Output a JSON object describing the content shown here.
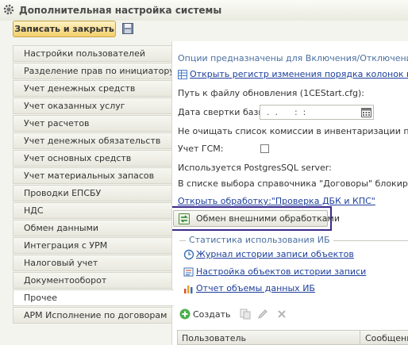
{
  "window": {
    "title": "Дополнительная настройка системы"
  },
  "toolbar": {
    "save_close_label": "Записать и закрыть"
  },
  "sidebar": {
    "items": [
      {
        "label": "Настройки пользователей"
      },
      {
        "label": "Разделение прав по инициатору"
      },
      {
        "label": "Учет денежных средств"
      },
      {
        "label": "Учет оказанных услуг"
      },
      {
        "label": "Учет расчетов"
      },
      {
        "label": "Учет денежных обязательств"
      },
      {
        "label": "Учет основных средств"
      },
      {
        "label": "Учет материальных запасов"
      },
      {
        "label": "Проводки ЕПСБУ"
      },
      {
        "label": "НДС"
      },
      {
        "label": "Обмен данными"
      },
      {
        "label": "Интеграция с УРМ"
      },
      {
        "label": "Налоговый учет"
      },
      {
        "label": "Документооборот"
      },
      {
        "label": "Прочее"
      },
      {
        "label": "АРМ Исполнение по договорам"
      }
    ],
    "active_index": 14
  },
  "main": {
    "options_text": "Опции предназначены для Включения/Отключения откры",
    "register_link": "Открыть регистр изменения порядка колонок в обраб",
    "update_file_label": "Путь к файлу обновления (1CEStart.cfg):",
    "collapse_date_label": "Дата свертки базы:",
    "collapse_date_value": ".  .      :  :",
    "commission_text": "Не очищать список комиссии в инвентаризации при копи",
    "gsm_label": "Учет ГСМ:",
    "gsm_checked": false,
    "postgres_text": "Используется PostgresSQL server:",
    "contracts_text": "В списке выбора справочника \"Договоры\" блокировать",
    "dbk_link": "Открыть обработку:\"Проверка ДБК и КПС\"",
    "exchange_button": "Обмен внешними обработками",
    "stats": {
      "title": "Статистика использования ИБ",
      "links": [
        {
          "label": "Журнал истории записи объектов",
          "icon": "history-icon"
        },
        {
          "label": "Настройка объектов истории записи",
          "icon": "settings-icon"
        },
        {
          "label": "Отчет объемы данных ИБ",
          "icon": "report-icon"
        }
      ]
    },
    "commands": {
      "create_label": "Создать"
    },
    "table": {
      "columns": [
        "Пользователь",
        "Сообщение"
      ]
    }
  }
}
